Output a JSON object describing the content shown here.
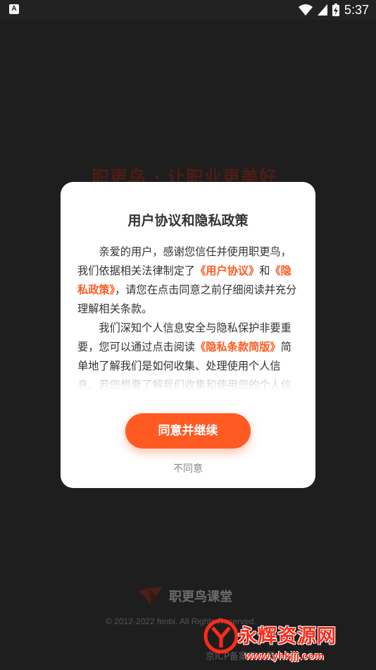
{
  "status_bar": {
    "time": "5:37",
    "left_badge": "A",
    "battery_text": "⚡"
  },
  "background": {
    "slogan": "职更鸟 · 让职业更美好",
    "brand_name": "职更鸟课堂",
    "copyright": "© 2012-2022 fenbi. All Rights Reserved.",
    "footer_text": "京ICP备案号设置"
  },
  "dialog": {
    "title": "用户协议和隐私政策",
    "para1_part1": "亲爱的用户，感谢您信任并使用职更鸟，我们依据相关法律制定了",
    "para1_link1": "《用户协议》",
    "para1_part2": "和",
    "para1_link2": "《隐私政策》",
    "para1_part3": "，请您在点击同意之前仔细阅读并充分理解相关条款。",
    "para2_part1": "我们深知个人信息安全与隐私保护非要重要，您可以通过点击阅读",
    "para2_link1": "《隐私条款简版》",
    "para2_part2": "简单地了解我们是如何收集、处理使用个人信息。若您想要了解我们收集和使用您的个人信息的详细内容，请仔细阅读",
    "agree_label": "同意并继续",
    "disagree_label": "不同意"
  },
  "watermark": {
    "title": "永辉资源网",
    "url": "www.yhkjjj.com"
  },
  "colors": {
    "accent": "#ff5a22",
    "overlay": "#1e1e1e",
    "dialog_bg": "#ffffff",
    "watermark_red": "#ff2a1a"
  }
}
